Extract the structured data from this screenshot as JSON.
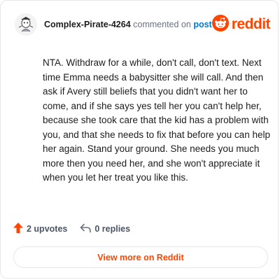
{
  "header": {
    "username": "Complex-Pirate-4264",
    "action_text": "commented on",
    "post_link": "post",
    "brand_name": "reddit"
  },
  "comment": {
    "body": "NTA. Withdraw for a while, don't call, don't text. Next time Emma needs a babysitter she will call. And then ask if Avery still beliefs that you didn't want her to come, and if she says yes tell her you can't help her, because she took care that the kid has a problem with you, and that she needs to fix that before you can help her again. Stand your ground. She needs you much more then you need her, and she won't appreciate it when you let her treat you like this."
  },
  "footer": {
    "upvotes_label": "2 upvotes",
    "replies_label": "0 replies"
  },
  "cta": {
    "label": "View more on Reddit"
  },
  "icons": {
    "avatar": "avatar-icon",
    "brand_logo": "reddit-logo-icon",
    "upvote": "upvote-arrow-icon",
    "reply": "reply-arrow-icon"
  },
  "colors": {
    "brand": "#ff4500",
    "link": "#0079d3",
    "muted": "#6b7280",
    "text": "#1c1c1c",
    "border": "#e5e7eb"
  }
}
